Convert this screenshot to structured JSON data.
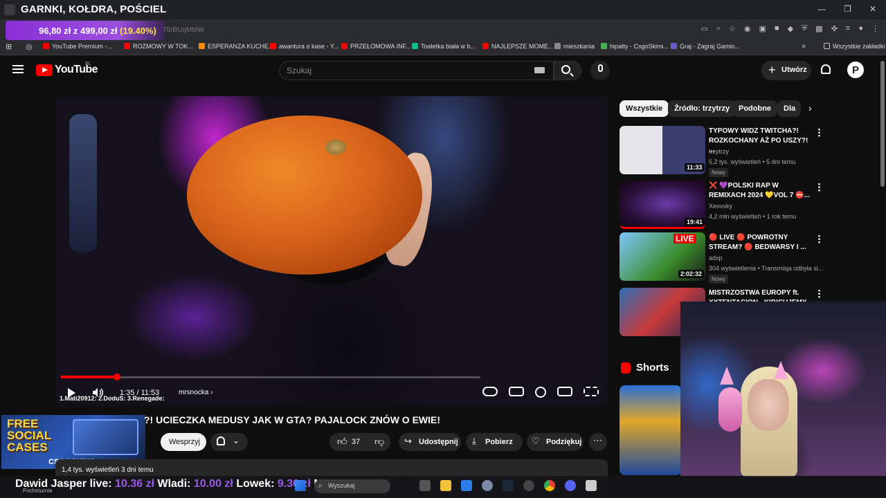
{
  "browser": {
    "tab_title": "GARNKI, KOŁDRA, POŚCIEL",
    "window_controls": [
      "—",
      "❐",
      "✕"
    ],
    "price_current": "96,80 zł",
    "price_separator": "z",
    "price_total": "499,00 zł",
    "price_pct": "(19.40%)",
    "url_fragment": "76rBUqMbNk",
    "bookmarks": [
      {
        "label": "YouTube Premium -...",
        "color": "#ff0000"
      },
      {
        "label": "ROZMOWY W TOK...",
        "color": "#ff0000"
      },
      {
        "label": "ESPERANZA KUCHE...",
        "color": "#ff8a00"
      },
      {
        "label": "awantura o kase - Y...",
        "color": "#ff0000"
      },
      {
        "label": "PRZEŁOMOWA INF...",
        "color": "#ff0000"
      },
      {
        "label": "Toaletka biała w b...",
        "color": "#00c08b"
      },
      {
        "label": "NAJLEPSZE MOME...",
        "color": "#ff0000"
      },
      {
        "label": "mieszkania",
        "color": "#888888"
      },
      {
        "label": "hipatty - CsgoSkins...",
        "color": "#4caf50"
      },
      {
        "label": "Graj - Zagraj Gamio...",
        "color": "#6a5acd"
      }
    ],
    "all_bookmarks": "Wszystkie zakładki"
  },
  "youtube": {
    "logo_text": "YouTube",
    "country": "PL",
    "search_placeholder": "Szukaj",
    "create_label": "Utwórz",
    "avatar_letter": "P"
  },
  "player": {
    "current_time": "1:35",
    "duration": "11:53",
    "time_display": "1:35 / 11:53",
    "chapter": "mrsnocka",
    "progress_fraction": 0.133,
    "overlay_text": "1.Mati20912: 2.DoduS: 3.Renegade:"
  },
  "video": {
    "title": "?! UCIECZKA MEDUSY JAK W GTA? PAJALOCK ZNÓW O EWIE!",
    "join_label": "Wesprzyj",
    "likes": "37",
    "share_label": "Udostępnij",
    "download_label": "Pobierz",
    "thanks_label": "Podziękuj",
    "views": "1,4 tys. wyświetleń",
    "age": "3 dni temu"
  },
  "ad": {
    "free_line1": "FREE",
    "free_line2": "SOCIAL",
    "free_line3": "CASES",
    "brand": "CSG◎SKINS"
  },
  "sidebar": {
    "chips": [
      "Wszystkie",
      "Źródło: trzytrzy",
      "Podobne",
      "Dla"
    ],
    "recommendations": [
      {
        "title": "TYPOWY WIDZ TWITCHA?! ROZKOCHANY AŻ PO USZY?! ...",
        "channel": "trzytrzy",
        "meta": "5,2 tys. wyświetleń • 5 dni temu",
        "duration": "11:33",
        "badge": "Nowy"
      },
      {
        "title": "❌ 💜POLSKI RAP W REMIXACH 2024 💛VOL 7 ⛔...",
        "channel": "Xeovsky",
        "meta": "4,2 mln wyświetleń • 1 rok temu",
        "duration": "19:41",
        "badge": ""
      },
      {
        "title": "🔴 LIVE 🔴 POWROTNY STREAM? 🔴 BEDWARSY I ...",
        "channel": "adxp",
        "meta": "304 wyświetlenia • Transmisja odbyła si...",
        "duration": "2:02:32",
        "badge": "Nowy"
      },
      {
        "title": "MISTRZOSTWA EUROPY ft. XXTENTACION - KIBICUJEMY",
        "channel": "",
        "meta": "",
        "duration": "",
        "badge": ""
      }
    ],
    "shorts_title": "Shorts"
  },
  "ticker": {
    "segments": [
      {
        "name": "Dawid Jasper live:",
        "amount": "10.36 zł"
      },
      {
        "name": "Wladi:",
        "amount": "10.00 zł"
      },
      {
        "name": "Lowek:",
        "amount": "9.36 zł"
      },
      {
        "name": "Ma",
        "amount": ""
      }
    ]
  },
  "taskbar": {
    "search_text": "Wyszukaj",
    "weather": "Pochmurnie"
  },
  "colors": {
    "accent_red": "#ff0000",
    "price_purple": "#8a2fd6",
    "ticker_amount": "#9b59e6"
  }
}
